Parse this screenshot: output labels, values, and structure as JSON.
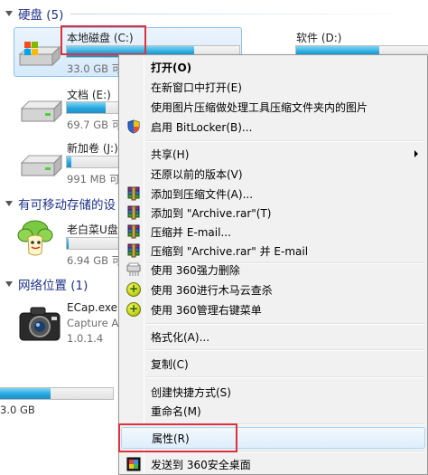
{
  "sections": {
    "hard_disks": "硬盘 (5)",
    "removable": "有可移动存储的设",
    "network": "网络位置 (1)"
  },
  "drives": {
    "c": {
      "name": "本地磁盘 (C:)",
      "free": "33.0 GB 可",
      "usage": 0.74
    },
    "d": {
      "name": "软件 (D:)",
      "usage": 0.62
    },
    "e": {
      "name": "文档 (E:)",
      "free": "69.7 GB 可",
      "usage": 0.55
    },
    "j": {
      "name": "新加卷 (J:)",
      "free": "991 MB 可",
      "usage": 0.08
    },
    "usb": {
      "name": "老白菜U盘",
      "free": "6.94 GB 可",
      "usage": 0.04
    },
    "bottom": {
      "free": "3.0 GB",
      "usage": 0.45
    }
  },
  "network_item": {
    "name": "ECap.exe",
    "sub1": "Capture A",
    "sub2": "1.0.1.4"
  },
  "menu": {
    "open": "打开(O)",
    "open_new_window": "在新窗口中打开(E)",
    "compress_images": "使用图片压缩做处理工具压缩文件夹内的图片",
    "bitlocker": "启用 BitLocker(B)...",
    "share": "共享(H)",
    "restore_versions": "还原以前的版本(V)",
    "add_to_archive": "添加到压缩文件(A)...",
    "add_to_archive_rar": "添加到 \"Archive.rar\"(T)",
    "compress_email": "压缩并 E-mail...",
    "compress_rar_email": "压缩到 \"Archive.rar\" 并 E-mail",
    "force_delete_360": "使用 360强力删除",
    "trojan_scan_360": "使用 360进行木马云查杀",
    "manage_menu_360": "使用 360管理右键菜单",
    "format": "格式化(A)...",
    "copy": "复制(C)",
    "create_shortcut": "创建快捷方式(S)",
    "rename": "重命名(M)",
    "properties": "属性(R)",
    "send_to_desktop_360": "发送到 360安全桌面"
  },
  "colors": {
    "accent_red": "#e0303a",
    "bar_fill": "#27a7df",
    "section_title": "#1e3287"
  }
}
